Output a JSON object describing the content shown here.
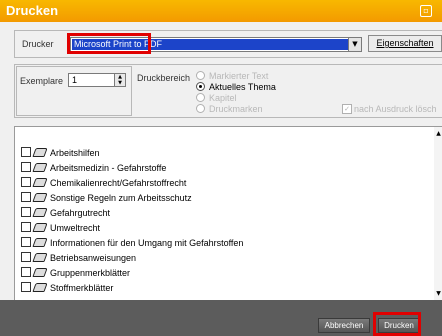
{
  "window": {
    "title": "Drucken",
    "control_icon": "minimize-icon"
  },
  "printer": {
    "label": "Drucker",
    "selected": "Microsoft Print to PDF",
    "properties_button": "Eigenschaften"
  },
  "copies": {
    "label": "Exemplare",
    "value": "1"
  },
  "print_range": {
    "label": "Druckbereich",
    "options": [
      {
        "label": "Markierter Text",
        "selected": false,
        "enabled": false
      },
      {
        "label": "Aktuelles Thema",
        "selected": true,
        "enabled": true
      },
      {
        "label": "Kapitel",
        "selected": false,
        "enabled": false
      },
      {
        "label": "Druckmarken",
        "selected": false,
        "enabled": false
      }
    ],
    "delete_after_print": {
      "label": "nach Ausdruck lösch",
      "checked": true,
      "enabled": false
    }
  },
  "topics": [
    {
      "label": "Arbeitshilfen"
    },
    {
      "label": "Arbeitsmedizin - Gefahrstoffe"
    },
    {
      "label": "Chemikalienrecht/Gefahrstoffrecht"
    },
    {
      "label": "Sonstige Regeln zum Arbeitsschutz"
    },
    {
      "label": "Gefahrgutrecht"
    },
    {
      "label": "Umweltrecht"
    },
    {
      "label": "Informationen für den Umgang mit Gefahrstoffen"
    },
    {
      "label": "Betriebsanweisungen"
    },
    {
      "label": "Gruppenmerkblätter"
    },
    {
      "label": "Stoffmerkblätter"
    }
  ],
  "footer": {
    "cancel_label": "Abbrechen",
    "print_label": "Drucken"
  }
}
